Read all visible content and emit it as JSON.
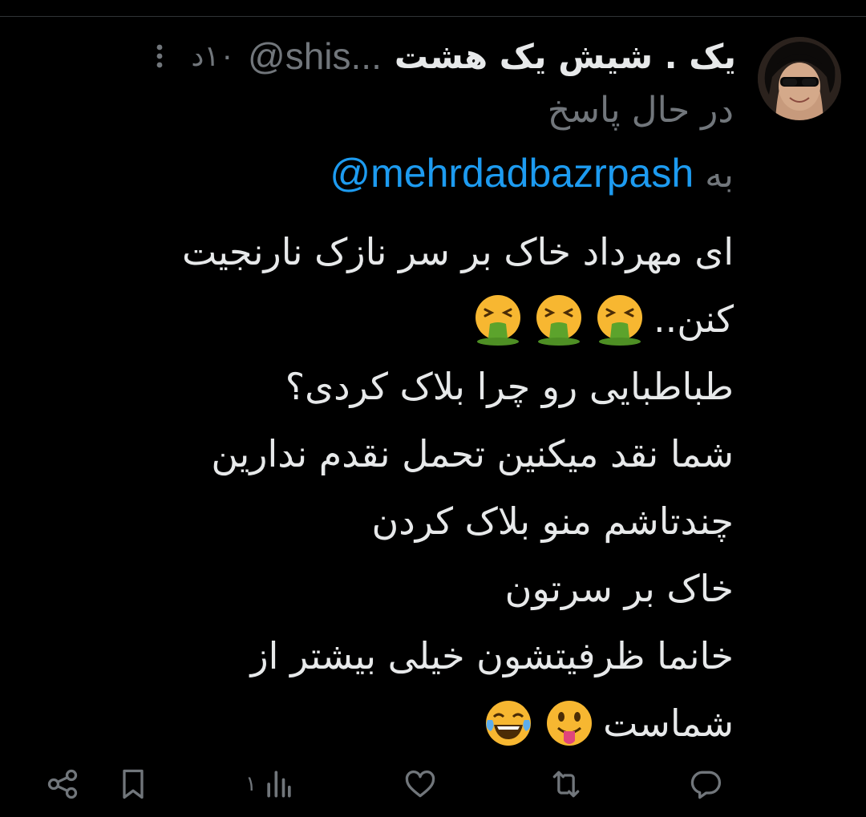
{
  "tweet": {
    "display_name": "یک . شیش یک هشت",
    "handle": "@shis...",
    "time": "۱۰د",
    "replying_status": "در حال پاسخ",
    "reply_prefix": "به",
    "reply_to": "@mehrdadbazrpash",
    "lines": [
      "ای مهرداد خاک بر سر نازک نارنجیت",
      "کنن..",
      "طباطبایی رو چرا بلاک کردی؟",
      "شما نقد میکنین تحمل نقدم ندارین",
      "چندتاشم منو بلاک کردن",
      "خاک بر سرتون",
      "خانما ظرفیتشون خیلی بیشتر از",
      "شماست"
    ],
    "emojis": {
      "line2": [
        "vomiting-face",
        "vomiting-face",
        "vomiting-face"
      ],
      "line8": [
        "face-with-tongue",
        "face-with-tears-of-joy"
      ]
    }
  },
  "actions": {
    "views_count": "۱"
  },
  "colors": {
    "background": "#000000",
    "text": "#e7e9ea",
    "muted": "#71767b",
    "link": "#1d9bf0",
    "divider": "#2f3336"
  }
}
